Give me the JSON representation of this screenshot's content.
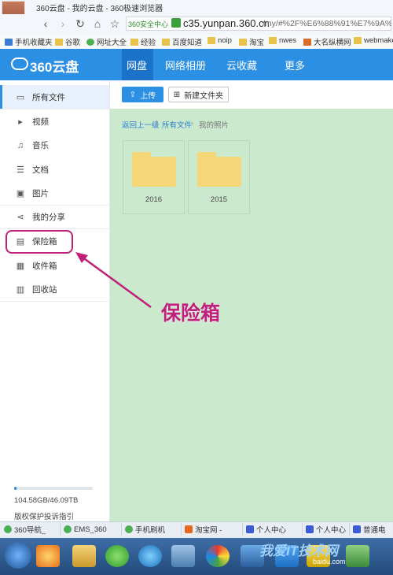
{
  "browser": {
    "window_title": "360云盘 - 我的云盘 - 360极速浏览器",
    "address_badge": "360安全中心",
    "address_domain": "c35.yunpan.360.cn",
    "address_path": "/my/#%2F%E6%88%91%E7%9A%84",
    "bookmarks": [
      "手机收藏夹",
      "谷歌",
      "网址大全",
      "经验",
      "百度知道",
      "noip",
      "淘宝",
      "nwes",
      "大名纵横网",
      "webmake"
    ]
  },
  "header": {
    "logo": "360云盘",
    "nav": [
      "网盘",
      "网络相册",
      "云收藏",
      "更多"
    ]
  },
  "sidebar": {
    "items": [
      "所有文件",
      "视频",
      "音乐",
      "文档",
      "图片",
      "我的分享",
      "保险箱",
      "收件箱",
      "回收站"
    ],
    "storage_text": "104.58GB/46.09TB",
    "storage_used_fraction": 0.002,
    "copyright": "版权保护投诉指引"
  },
  "toolbar": {
    "upload": "上传",
    "new_folder": "新建文件夹"
  },
  "breadcrumb": [
    "返回上一级",
    "所有文件",
    "我的照片"
  ],
  "folders": [
    "2016",
    "2015"
  ],
  "annotation": {
    "callout": "保险箱",
    "color": "#c0207a"
  },
  "tabs": [
    "360导航_",
    "EMS_360",
    "手机刷机",
    "淘宝网 -",
    "个人中心",
    "个人中心",
    "普通电"
  ],
  "watermark": {
    "text": "我爱IT技术网",
    "sub": "baidu.com"
  }
}
